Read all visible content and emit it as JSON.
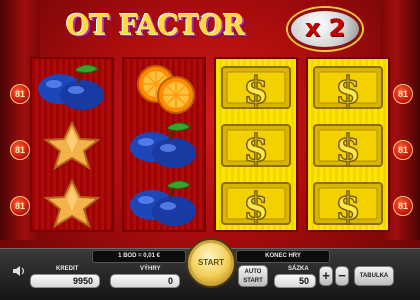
{
  "logo": {
    "text": "OT FACTOR",
    "badge": "x 2"
  },
  "reels": [
    [
      "plums",
      "star",
      "star"
    ],
    [
      "oranges",
      "plums",
      "plums"
    ],
    [
      "dollar",
      "dollar",
      "dollar"
    ],
    [
      "dollar",
      "dollar",
      "dollar"
    ]
  ],
  "line_markers": [
    "81",
    "81",
    "81",
    "81",
    "81",
    "81"
  ],
  "panel": {
    "denomination": "1 BOD = 0,01 €",
    "end_game": "KONEC HRY",
    "credit_label": "KREDIT",
    "credit_value": "9950",
    "win_label": "VÝHRY",
    "win_value": "0",
    "start_label": "START",
    "autostart_line1": "AUTO",
    "autostart_line2": "START",
    "bet_label": "SÁZKA",
    "bet_value": "50",
    "plus": "+",
    "minus": "−",
    "table_label": "TABULKA"
  },
  "colors": {
    "background": "#b20a0a",
    "gold": "#f4d05a",
    "reel_yellow": "#ffe600"
  }
}
